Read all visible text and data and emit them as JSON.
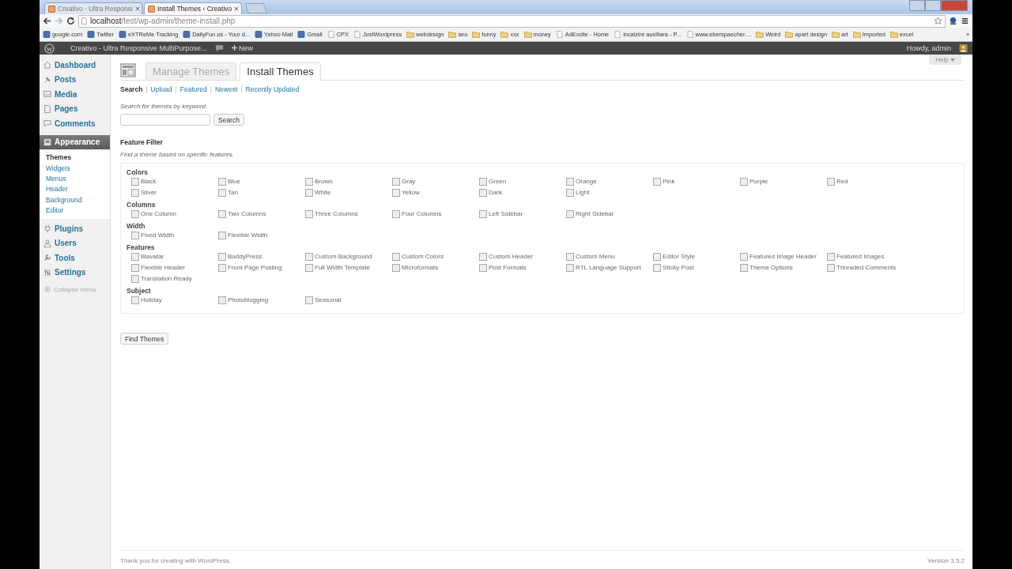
{
  "browser": {
    "tabs": [
      {
        "title": "Creativo - Ultra Responsi",
        "selected": false
      },
      {
        "title": "Install Themes ‹ Creativo",
        "selected": true
      }
    ],
    "address": {
      "host": "localhost",
      "path": "/test/wp-admin/theme-install.php"
    },
    "bookmarks": [
      {
        "label": "google.com",
        "kind": "site"
      },
      {
        "label": "Twitter",
        "kind": "site"
      },
      {
        "label": "eXTReMe Tracking",
        "kind": "site"
      },
      {
        "label": "DailyFun.us - Your d...",
        "kind": "site"
      },
      {
        "label": "Yahoo Mail",
        "kind": "site"
      },
      {
        "label": "Gmail",
        "kind": "site"
      },
      {
        "label": "CPX",
        "kind": "page"
      },
      {
        "label": "JustWordpress",
        "kind": "page"
      },
      {
        "label": "webdesign",
        "kind": "folder"
      },
      {
        "label": "seo",
        "kind": "folder"
      },
      {
        "label": "funny",
        "kind": "folder"
      },
      {
        "label": "xxx",
        "kind": "folder"
      },
      {
        "label": "money",
        "kind": "folder"
      },
      {
        "label": "AdExcite - Home",
        "kind": "page"
      },
      {
        "label": "incalzire auxiliara - P...",
        "kind": "page"
      },
      {
        "label": "www.eberspaecher....",
        "kind": "page"
      },
      {
        "label": "Weird",
        "kind": "folder"
      },
      {
        "label": "apart design",
        "kind": "folder"
      },
      {
        "label": "art",
        "kind": "folder"
      },
      {
        "label": "Imported",
        "kind": "folder"
      },
      {
        "label": "excel",
        "kind": "folder"
      }
    ],
    "more": "»"
  },
  "admin_bar": {
    "site": "Creativo - Ultra Responsive MultiPurpose...",
    "new": "New",
    "greeting": "Howdy, admin"
  },
  "sidebar": {
    "items": [
      {
        "label": "Dashboard",
        "selected": false
      },
      {
        "label": "Posts",
        "selected": false
      },
      {
        "label": "Media",
        "selected": false
      },
      {
        "label": "Pages",
        "selected": false
      },
      {
        "label": "Comments",
        "selected": false
      },
      {
        "label": "Appearance",
        "selected": true,
        "children": [
          {
            "label": "Themes",
            "selected": true
          },
          {
            "label": "Widgets",
            "selected": false
          },
          {
            "label": "Menus",
            "selected": false
          },
          {
            "label": "Header",
            "selected": false
          },
          {
            "label": "Background",
            "selected": false
          },
          {
            "label": "Editor",
            "selected": false
          }
        ]
      },
      {
        "label": "Plugins",
        "selected": false
      },
      {
        "label": "Users",
        "selected": false
      },
      {
        "label": "Tools",
        "selected": false
      },
      {
        "label": "Settings",
        "selected": false
      }
    ],
    "collapse": "Collapse menu"
  },
  "help": "Help",
  "tabs": [
    {
      "label": "Manage Themes",
      "selected": false
    },
    {
      "label": "Install Themes",
      "selected": true
    }
  ],
  "subnav_separator": "|",
  "subnav": [
    {
      "label": "Search",
      "selected": true
    },
    {
      "label": "Upload",
      "selected": false
    },
    {
      "label": "Featured",
      "selected": false
    },
    {
      "label": "Newest",
      "selected": false
    },
    {
      "label": "Recently Updated",
      "selected": false
    }
  ],
  "search": {
    "hint": "Search for themes by keyword.",
    "button": "Search"
  },
  "filter": {
    "title": "Feature Filter",
    "description": "Find a theme based on specific features.",
    "groups": [
      {
        "name": "Colors",
        "options": [
          {
            "label": "Black",
            "checked": false
          },
          {
            "label": "Blue",
            "checked": false
          },
          {
            "label": "Brown",
            "checked": false
          },
          {
            "label": "Gray",
            "checked": false
          },
          {
            "label": "Green",
            "checked": false
          },
          {
            "label": "Orange",
            "checked": false
          },
          {
            "label": "Pink",
            "checked": false
          },
          {
            "label": "Purple",
            "checked": false
          },
          {
            "label": "Red",
            "checked": false
          },
          {
            "label": "Silver",
            "checked": false
          },
          {
            "label": "Tan",
            "checked": false
          },
          {
            "label": "White",
            "checked": false
          },
          {
            "label": "Yellow",
            "checked": false
          },
          {
            "label": "Dark",
            "checked": false
          },
          {
            "label": "Light",
            "checked": false
          }
        ]
      },
      {
        "name": "Columns",
        "options": [
          {
            "label": "One Column",
            "checked": false
          },
          {
            "label": "Two Columns",
            "checked": false
          },
          {
            "label": "Three Columns",
            "checked": false
          },
          {
            "label": "Four Columns",
            "checked": false
          },
          {
            "label": "Left Sidebar",
            "checked": false
          },
          {
            "label": "Right Sidebar",
            "checked": false
          }
        ]
      },
      {
        "name": "Width",
        "options": [
          {
            "label": "Fixed Width",
            "checked": false
          },
          {
            "label": "Flexible Width",
            "checked": false
          }
        ]
      },
      {
        "name": "Features",
        "options": [
          {
            "label": "Blavatar",
            "checked": false
          },
          {
            "label": "BuddyPress",
            "checked": false
          },
          {
            "label": "Custom Background",
            "checked": false
          },
          {
            "label": "Custom Colors",
            "checked": false
          },
          {
            "label": "Custom Header",
            "checked": false
          },
          {
            "label": "Custom Menu",
            "checked": false
          },
          {
            "label": "Editor Style",
            "checked": false
          },
          {
            "label": "Featured Image Header",
            "checked": false
          },
          {
            "label": "Featured Images",
            "checked": false
          },
          {
            "label": "Flexible Header",
            "checked": false
          },
          {
            "label": "Front Page Posting",
            "checked": false
          },
          {
            "label": "Full Width Template",
            "checked": false
          },
          {
            "label": "Microformats",
            "checked": false
          },
          {
            "label": "Post Formats",
            "checked": false
          },
          {
            "label": "RTL Language Support",
            "checked": false
          },
          {
            "label": "Sticky Post",
            "checked": false
          },
          {
            "label": "Theme Options",
            "checked": false
          },
          {
            "label": "Threaded Comments",
            "checked": false
          },
          {
            "label": "Translation Ready",
            "checked": false
          }
        ]
      },
      {
        "name": "Subject",
        "options": [
          {
            "label": "Holiday",
            "checked": false
          },
          {
            "label": "Photoblogging",
            "checked": false
          },
          {
            "label": "Seasonal",
            "checked": false
          }
        ]
      }
    ],
    "button": "Find Themes"
  },
  "footer": {
    "thanks": "Thank you for creating with WordPress.",
    "version": "Version 3.5.2"
  }
}
